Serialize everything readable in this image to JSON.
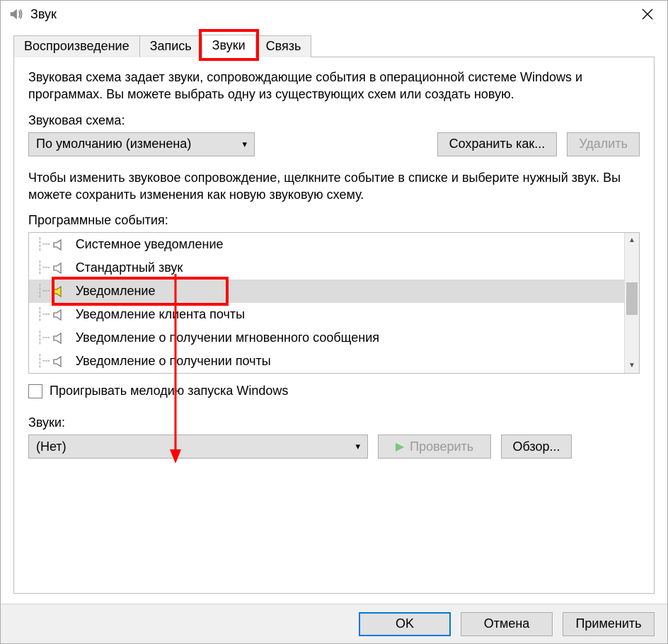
{
  "titlebar": {
    "title": "Звук"
  },
  "tabs": {
    "playback": "Воспроизведение",
    "recording": "Запись",
    "sounds": "Звуки",
    "communications": "Связь",
    "active": "sounds"
  },
  "sounds_panel": {
    "description": "Звуковая схема задает звуки, сопровождающие события в операционной системе Windows и программах. Вы можете выбрать одну из существующих схем или создать новую.",
    "scheme_label": "Звуковая схема:",
    "scheme_value": "По умолчанию (изменена)",
    "save_as": "Сохранить как...",
    "delete": "Удалить",
    "events_description": "Чтобы изменить звуковое сопровождение, щелкните событие в списке и выберите нужный звук. Вы можете сохранить изменения как новую звуковую схему.",
    "events_label": "Программные события:",
    "events": [
      {
        "label": "Системное уведомление",
        "has_sound": false,
        "selected": false
      },
      {
        "label": "Стандартный звук",
        "has_sound": false,
        "selected": false
      },
      {
        "label": "Уведомление",
        "has_sound": true,
        "selected": true
      },
      {
        "label": "Уведомление клиента почты",
        "has_sound": false,
        "selected": false
      },
      {
        "label": "Уведомление о получении мгновенного сообщения",
        "has_sound": false,
        "selected": false
      },
      {
        "label": "Уведомление о получении почты",
        "has_sound": false,
        "selected": false
      }
    ],
    "play_startup_label": "Проигрывать мелодию запуска Windows",
    "play_startup_checked": false,
    "sounds_label": "Звуки:",
    "sound_value": "(Нет)",
    "test": "Проверить",
    "browse": "Обзор..."
  },
  "dialog_buttons": {
    "ok": "OK",
    "cancel": "Отмена",
    "apply": "Применить"
  }
}
